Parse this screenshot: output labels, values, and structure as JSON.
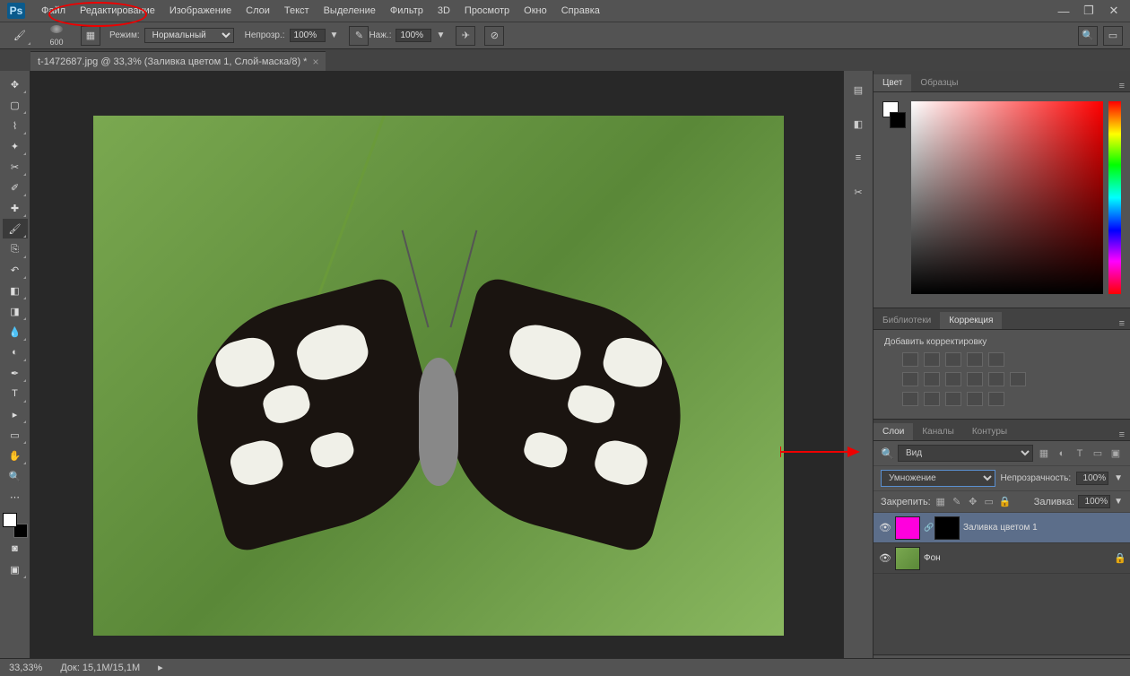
{
  "menubar": {
    "items": [
      "Файл",
      "Редактирование",
      "Изображение",
      "Слои",
      "Текст",
      "Выделение",
      "Фильтр",
      "3D",
      "Просмотр",
      "Окно",
      "Справка"
    ]
  },
  "optbar": {
    "brush_size": "600",
    "mode_label": "Режим:",
    "mode_value": "Нормальный",
    "opacity_label": "Непрозр.:",
    "opacity_value": "100%",
    "flow_label": "Наж.:",
    "flow_value": "100%"
  },
  "document": {
    "tab_title": "t-1472687.jpg @ 33,3% (Заливка цветом 1, Слой-маска/8) *"
  },
  "panels": {
    "color": {
      "tabs": [
        "Цвет",
        "Образцы"
      ],
      "active": 0
    },
    "adjustments": {
      "tabs": [
        "Библиотеки",
        "Коррекция"
      ],
      "active": 1,
      "add_label": "Добавить корректировку"
    },
    "layers": {
      "tabs": [
        "Слои",
        "Каналы",
        "Контуры"
      ],
      "active": 0,
      "kind_label": "Вид",
      "blend_mode": "Умножение",
      "opacity_label": "Непрозрачность:",
      "opacity_value": "100%",
      "lock_label": "Закрепить:",
      "fill_label": "Заливка:",
      "fill_value": "100%",
      "items": [
        {
          "name": "Заливка цветом 1",
          "mask": true,
          "selected": true,
          "fill": "#ff00dd"
        },
        {
          "name": "Фон",
          "locked": true
        }
      ]
    }
  },
  "statusbar": {
    "zoom": "33,33%",
    "doc_info": "Док: 15,1M/15,1M"
  }
}
